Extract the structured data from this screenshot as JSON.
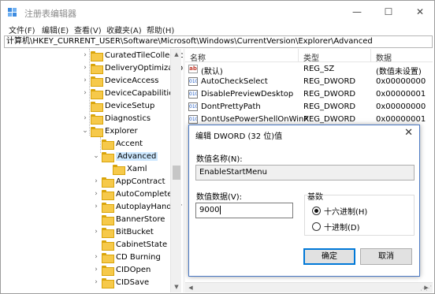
{
  "window": {
    "title": "注册表编辑器"
  },
  "window_controls": {
    "minimize": "—",
    "maximize": "☐",
    "close": "✕"
  },
  "menu": [
    "文件(F)",
    "编辑(E)",
    "查看(V)",
    "收藏夹(A)",
    "帮助(H)"
  ],
  "address": "计算机\\HKEY_CURRENT_USER\\Software\\Microsoft\\Windows\\CurrentVersion\\Explorer\\Advanced",
  "tree": [
    {
      "label": "CuratedTileCollectic",
      "expander": "›"
    },
    {
      "label": "DeliveryOptimizatio",
      "expander": "›"
    },
    {
      "label": "DeviceAccess",
      "expander": "›"
    },
    {
      "label": "DeviceCapabilities",
      "expander": "›"
    },
    {
      "label": "DeviceSetup",
      "expander": ""
    },
    {
      "label": "Diagnostics",
      "expander": "›"
    },
    {
      "label": "Explorer",
      "expander": "⌄"
    },
    {
      "label": "Accent",
      "expander": ""
    },
    {
      "label": "Advanced",
      "expander": "⌄",
      "selected": true
    },
    {
      "label": "Xaml",
      "expander": ""
    },
    {
      "label": "AppContract",
      "expander": "›"
    },
    {
      "label": "AutoComplete",
      "expander": "›"
    },
    {
      "label": "AutoplayHandler",
      "expander": "›"
    },
    {
      "label": "BannerStore",
      "expander": ""
    },
    {
      "label": "BitBucket",
      "expander": "›"
    },
    {
      "label": "CabinetState",
      "expander": ""
    },
    {
      "label": "CD Burning",
      "expander": "›"
    },
    {
      "label": "CIDOpen",
      "expander": "›"
    },
    {
      "label": "CIDSave",
      "expander": "›"
    }
  ],
  "list": {
    "columns": {
      "name": "名称",
      "type": "类型",
      "data": "数据"
    },
    "rows": [
      {
        "icon": "string-value-icon",
        "icon_text": "ab",
        "name": "(默认)",
        "type": "REG_SZ",
        "data": "(数值未设置)"
      },
      {
        "icon": "dword-value-icon",
        "icon_text": "010",
        "name": "AutoCheckSelect",
        "type": "REG_DWORD",
        "data": "0x00000000"
      },
      {
        "icon": "dword-value-icon",
        "icon_text": "010",
        "name": "DisablePreviewDesktop",
        "type": "REG_DWORD",
        "data": "0x00000001"
      },
      {
        "icon": "dword-value-icon",
        "icon_text": "010",
        "name": "DontPrettyPath",
        "type": "REG_DWORD",
        "data": "0x00000000"
      },
      {
        "icon": "dword-value-icon",
        "icon_text": "010",
        "name": "DontUsePowerShellOnWinX",
        "type": "REG_DWORD",
        "data": "0x00000001"
      }
    ]
  },
  "dialog": {
    "title": "编辑 DWORD (32 位)值",
    "close": "✕",
    "value_name_label": "数值名称(N):",
    "value_name": "EnableStartMenu",
    "value_data_label": "数值数据(V):",
    "value_data": "9000",
    "base_label": "基数",
    "radio_hex": "十六进制(H)",
    "radio_dec": "十进制(D)",
    "selected_base": "hex",
    "ok": "确定",
    "cancel": "取消"
  },
  "colors": {
    "accent": "#0078d7",
    "selection": "#cde8ff",
    "folder": "#f6c94a"
  }
}
